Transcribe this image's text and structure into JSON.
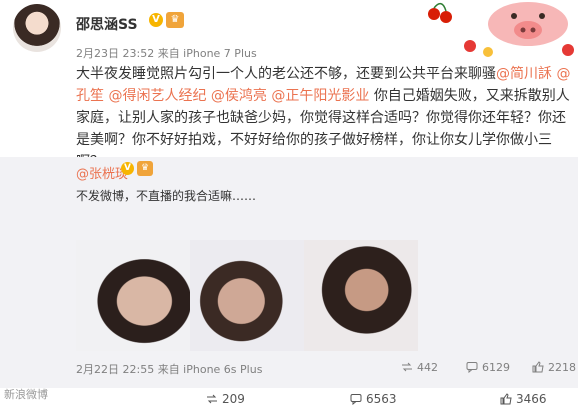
{
  "post": {
    "author": "邵思涵SS",
    "verified_mark": "V",
    "crown_mark": "♛",
    "meta": "2月23日 23:52 来自 iPhone 7 Plus",
    "content": {
      "p1": "大半夜发睡觉照片勾引一个人的老公还不够，还要到公共平台来聊骚",
      "m1": "@简川訸",
      "m2": "@孔笙",
      "m3": "@得闲艺人经纪",
      "m4": "@侯鸿亮",
      "m5": "@正午阳光影业",
      "p2": "你自己婚姻失败，又来拆散别人家庭，让别人家的孩子也缺爸少妈，你觉得这样合适吗？你觉得你还年轻？你还是美啊？你不好好拍戏，不好好给你的孩子做好榜样，你让你女儿学你做小三啊？"
    }
  },
  "repost": {
    "author": "@张桄琰",
    "verified_mark": "V",
    "crown_mark": "♛",
    "text": "不发微博，不直播的我合适嘛……",
    "meta": "2月22日 22:55 来自 iPhone 6s Plus",
    "repost_count": "442",
    "comment_count": "6129",
    "like_count": "2218"
  },
  "footer": {
    "repost_count": "209",
    "comment_count": "6563",
    "like_count": "3466"
  },
  "watermark": "新浪微博",
  "colors": {
    "mention": "#eb7350",
    "verified": "#f7b500",
    "repost_bg": "#f2f2f5"
  }
}
